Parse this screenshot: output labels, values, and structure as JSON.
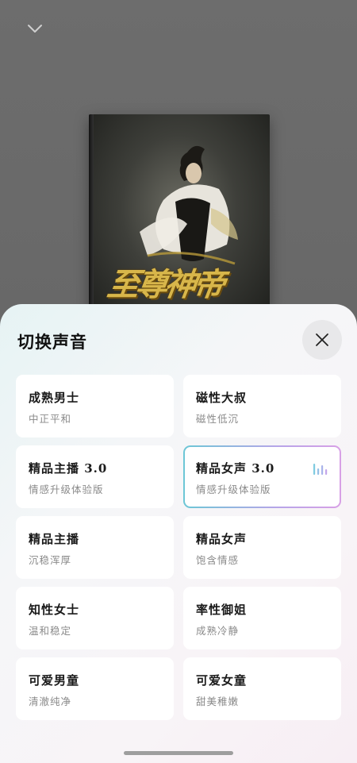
{
  "player": {
    "collapse_icon": "chevron-down-icon",
    "book_cover_title": "至尊神帝"
  },
  "sheet": {
    "title": "切换声音",
    "close_icon": "close-icon",
    "accent_colors": [
      "#6cc7d6",
      "#d8a0e6"
    ],
    "selected_index": 3,
    "voices": [
      {
        "name": "成熟男士",
        "desc": "中正平和"
      },
      {
        "name": "磁性大叔",
        "desc": "磁性低沉"
      },
      {
        "name": "精品主播 3.0",
        "desc": "情感升级体验版"
      },
      {
        "name": "精品女声 3.0",
        "desc": "情感升级体验版",
        "status_icon": "sound-wave-icon"
      },
      {
        "name": "精品主播",
        "desc": "沉稳浑厚"
      },
      {
        "name": "精品女声",
        "desc": "饱含情感"
      },
      {
        "name": "知性女士",
        "desc": "温和稳定"
      },
      {
        "name": "率性御姐",
        "desc": "成熟冷静"
      },
      {
        "name": "可爱男童",
        "desc": "清澈纯净"
      },
      {
        "name": "可爱女童",
        "desc": "甜美稚嫩"
      }
    ]
  }
}
